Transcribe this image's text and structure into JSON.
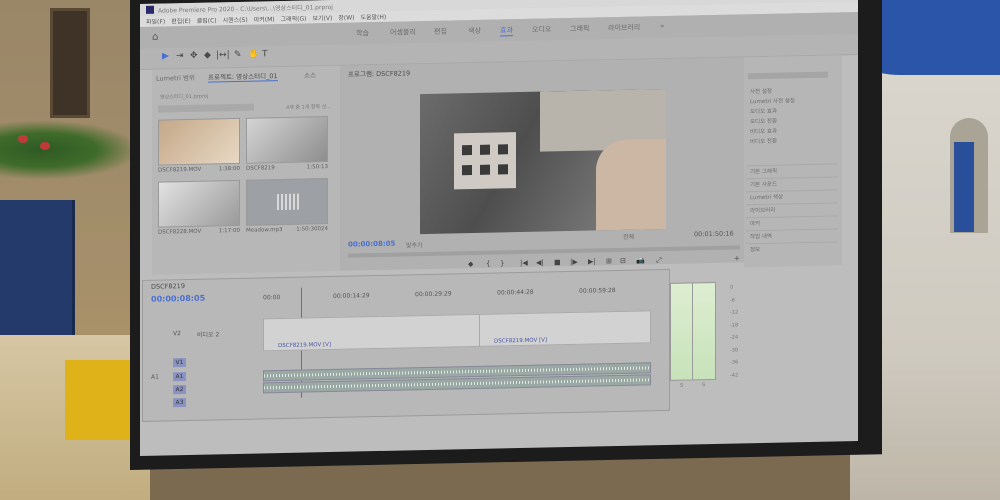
{
  "titlebar": {
    "title": "Adobe Premiere Pro 2020 - C:\\Users\\...\\영상스터디_01.prproj"
  },
  "menubar": {
    "items": [
      "파일(F)",
      "편집(E)",
      "클립(C)",
      "시퀀스(S)",
      "마커(M)",
      "그래픽(G)",
      "보기(V)",
      "창(W)",
      "도움말(H)"
    ]
  },
  "workspaces": {
    "items": [
      {
        "label": "학습",
        "active": false
      },
      {
        "label": "어셈블리",
        "active": false
      },
      {
        "label": "편집",
        "active": false
      },
      {
        "label": "색상",
        "active": false
      },
      {
        "label": "효과",
        "active": true
      },
      {
        "label": "오디오",
        "active": false
      },
      {
        "label": "그래픽",
        "active": false
      },
      {
        "label": "라이브러리",
        "active": false
      }
    ],
    "more": "»"
  },
  "tools": [
    "▶",
    "⇥",
    "✥",
    "◆",
    "|↔|",
    "✎",
    "✋",
    "T"
  ],
  "project_panel": {
    "tabs": [
      "Lumetri 범위",
      "프로젝트: 영상스터디_01",
      "소스"
    ],
    "path": "영상스터디_01.prproj",
    "item_count": "4개 중 1개 항목 선...",
    "clips": [
      {
        "name": "DSCF8219.MOV",
        "duration": "1:38:00"
      },
      {
        "name": "DSCF8219",
        "duration": "1:50:13"
      },
      {
        "name": "DSCF8228.MOV",
        "duration": "1:17:00"
      },
      {
        "name": "Meadow.mp3",
        "duration": "1:50:30024"
      }
    ]
  },
  "program_monitor": {
    "tab": "프로그램: DSCF8219",
    "timecode_current": "00:00:08:05",
    "fit": "맞추기",
    "quality": "전체",
    "timecode_duration": "00:01:50:16",
    "transport": [
      "◆",
      "{",
      "}",
      "|◀",
      "◀|",
      "■",
      "|▶",
      "▶|",
      "⊞",
      "⊟",
      "📷",
      "⤢",
      "+"
    ]
  },
  "effects_panel": {
    "tree": [
      "사전 설정",
      "Lumetri 사전 설정",
      "오디오 효과",
      "오디오 전환",
      "비디오 효과",
      "비디오 전환"
    ],
    "categories": [
      "기본 그래픽",
      "기본 사운드",
      "Lumetri 색상",
      "라이브러리",
      "마커",
      "작업 내역",
      "정보"
    ]
  },
  "timeline": {
    "tab": "DSCF8219",
    "timecode": "00:00:08:05",
    "ruler": [
      "00:00",
      "00:00:14:29",
      "00:00:29:29",
      "00:00:44:28",
      "00:00:59:28"
    ],
    "video_track_label": "비디오 2",
    "tracks": [
      "V2",
      "V1",
      "A1",
      "A2",
      "A3"
    ],
    "clips": [
      "DSCF8219.MOV [V]",
      "DSCF8219.MOV [V]"
    ]
  },
  "meter": {
    "scale": [
      "0",
      "-6",
      "-12",
      "-18",
      "-24",
      "-30",
      "-36",
      "-42",
      "-48"
    ],
    "channels": [
      "S",
      "S"
    ]
  }
}
